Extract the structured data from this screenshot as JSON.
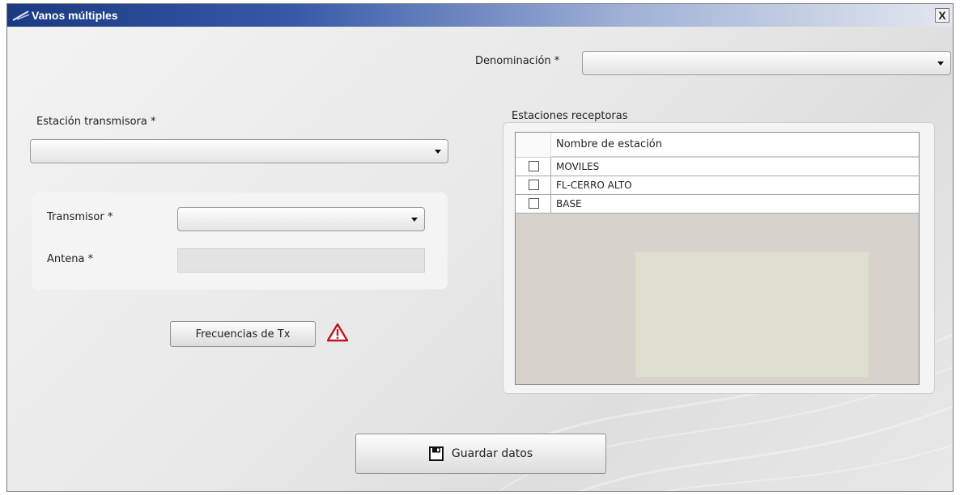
{
  "window": {
    "title": "Vanos múltiples",
    "close_label": "X"
  },
  "form": {
    "denominacion_label": "Denominación *",
    "denominacion_value": "",
    "estacion_tx_label": "Estación transmisora *",
    "estacion_tx_value": "",
    "transmisor_label": "Transmisor *",
    "transmisor_value": "",
    "antena_label": "Antena *",
    "antena_value": ""
  },
  "frecuencias_button": "Frecuencias de Tx",
  "receptoras": {
    "group_title": "Estaciones receptoras",
    "column_header": "Nombre de estación",
    "rows": [
      {
        "name": "MOVILES",
        "checked": false
      },
      {
        "name": "FL-CERRO ALTO",
        "checked": false
      },
      {
        "name": "BASE",
        "checked": false
      }
    ]
  },
  "save_button": "Guardar datos",
  "colors": {
    "titlebar": "#1b3a82",
    "warning": "#c0171d"
  }
}
